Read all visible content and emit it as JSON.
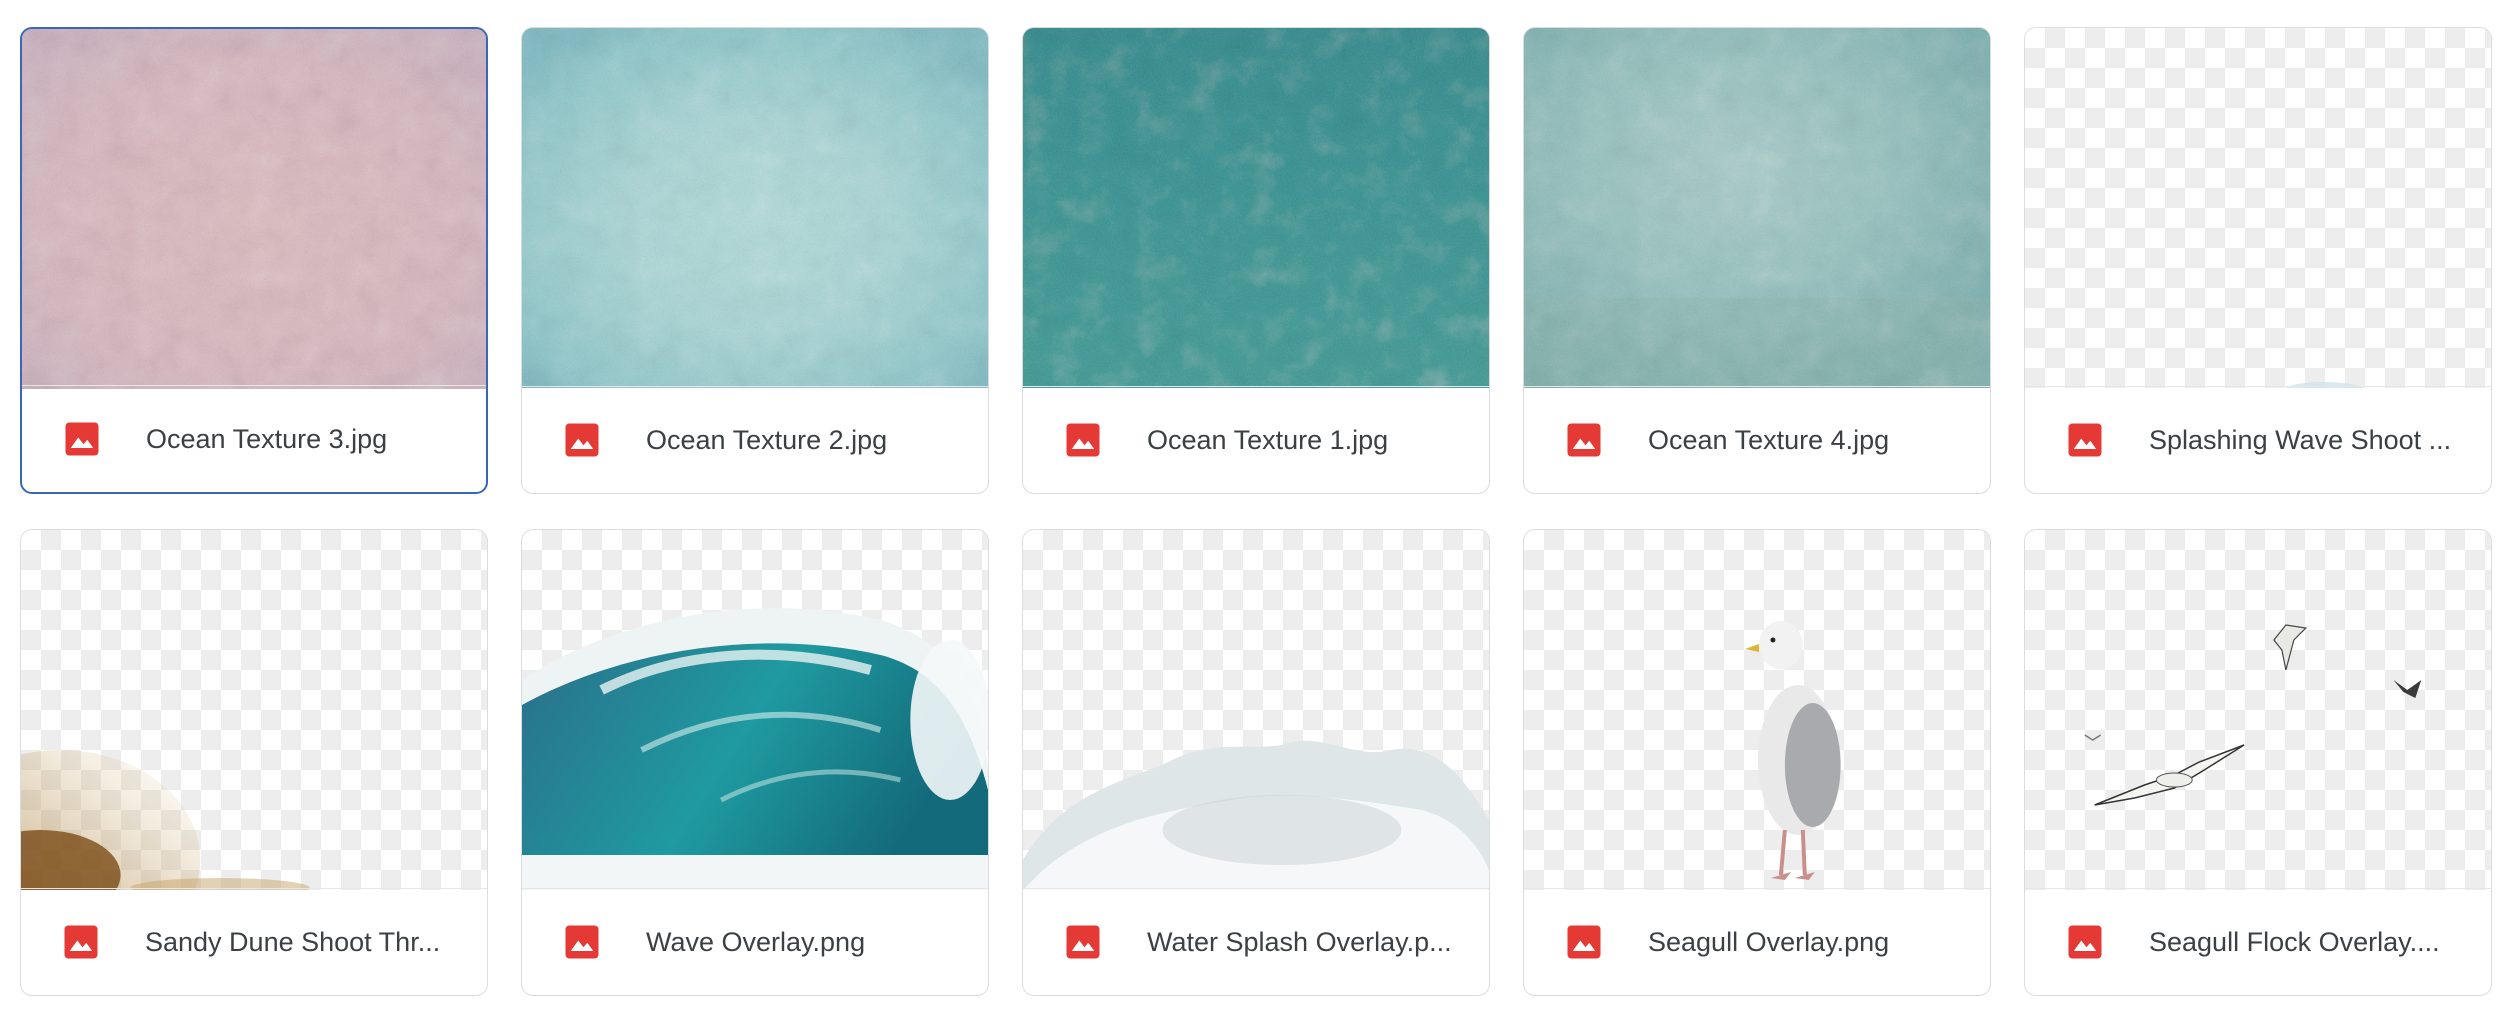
{
  "files": [
    {
      "name": "Ocean Texture 3.jpg",
      "icon": "image-file-icon",
      "selected": true
    },
    {
      "name": "Ocean Texture 2.jpg",
      "icon": "image-file-icon"
    },
    {
      "name": "Ocean Texture 1.jpg",
      "icon": "image-file-icon"
    },
    {
      "name": "Ocean Texture 4.jpg",
      "icon": "image-file-icon"
    },
    {
      "name": "Splashing Wave Shoot ...",
      "icon": "image-file-icon"
    },
    {
      "name": "Sandy Dune Shoot Thr...",
      "icon": "image-file-icon"
    },
    {
      "name": "Wave Overlay.png",
      "icon": "image-file-icon"
    },
    {
      "name": "Water Splash Overlay.p...",
      "icon": "image-file-icon"
    },
    {
      "name": "Seagull Overlay.png",
      "icon": "image-file-icon"
    },
    {
      "name": "Seagull Flock Overlay....",
      "icon": "image-file-icon"
    }
  ],
  "colors": {
    "file_icon_red": "#e53935",
    "selected_border": "#3a66b8",
    "card_border": "#dadce0"
  }
}
